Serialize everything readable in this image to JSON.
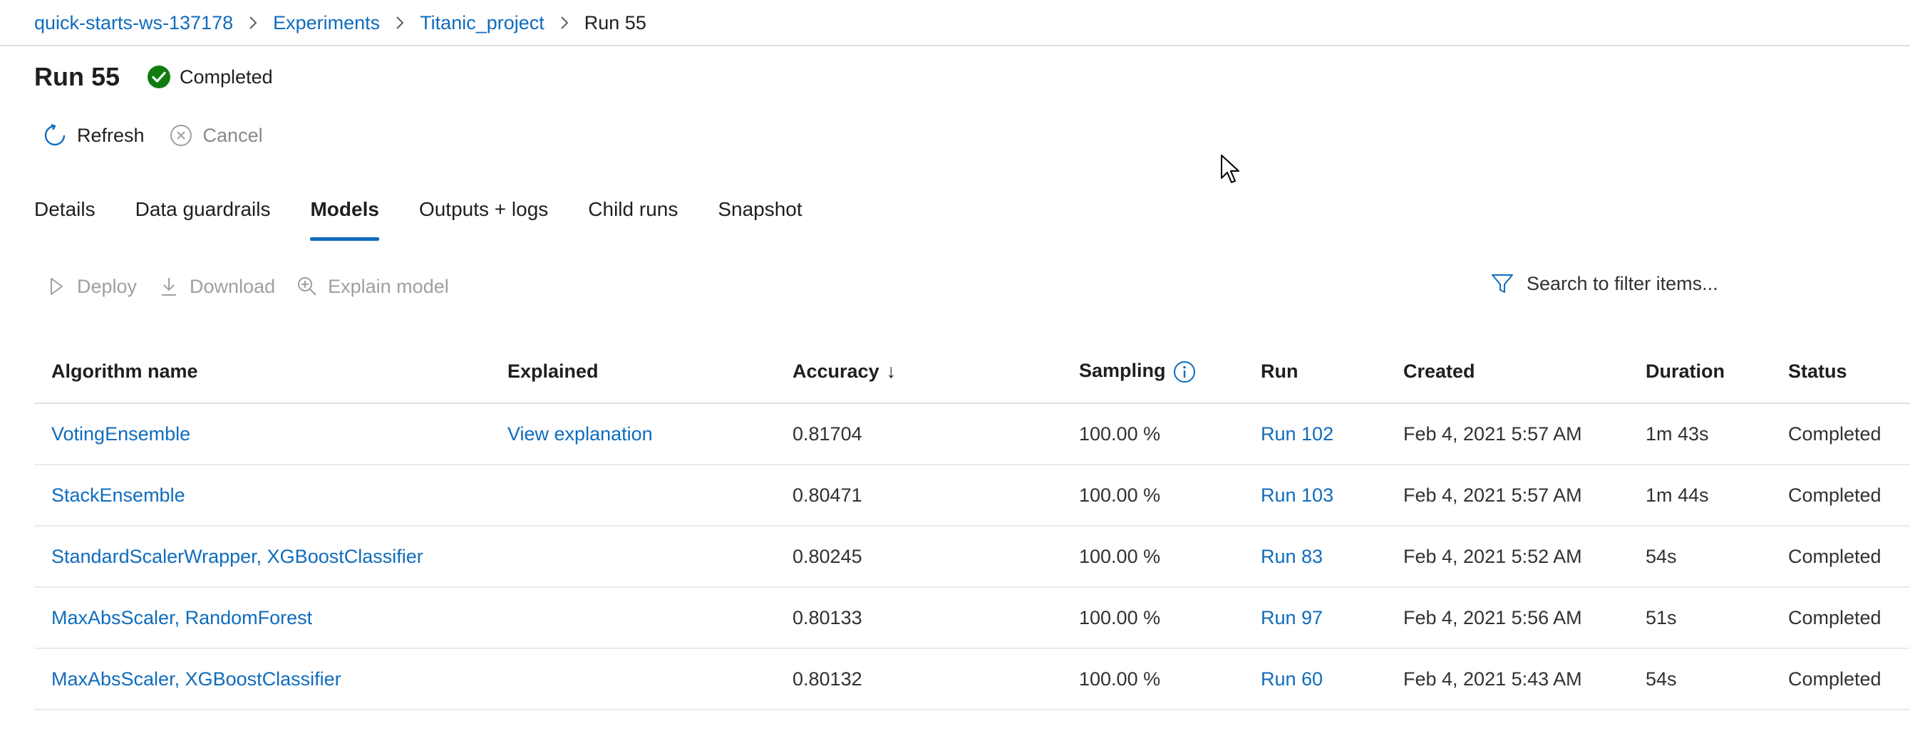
{
  "breadcrumb": {
    "items": [
      "quick-starts-ws-137178",
      "Experiments",
      "Titanic_project"
    ],
    "current": "Run 55"
  },
  "header": {
    "title": "Run 55",
    "status": "Completed",
    "status_color": "#107c10"
  },
  "commands": {
    "refresh": "Refresh",
    "cancel": "Cancel"
  },
  "tabs": [
    {
      "label": "Details"
    },
    {
      "label": "Data guardrails"
    },
    {
      "label": "Models",
      "active": true
    },
    {
      "label": "Outputs + logs"
    },
    {
      "label": "Child runs"
    },
    {
      "label": "Snapshot"
    }
  ],
  "toolbar": {
    "deploy": "Deploy",
    "download": "Download",
    "explain": "Explain model",
    "search_placeholder": "Search to filter items..."
  },
  "table": {
    "columns": {
      "algorithm": "Algorithm name",
      "explained": "Explained",
      "accuracy": "Accuracy",
      "accuracy_sort": "↓",
      "sampling": "Sampling",
      "run": "Run",
      "created": "Created",
      "duration": "Duration",
      "status": "Status"
    },
    "rows": [
      {
        "algorithm": "VotingEnsemble",
        "explained": "View explanation",
        "accuracy": "0.81704",
        "sampling": "100.00 %",
        "run": "Run 102",
        "created": "Feb 4, 2021 5:57 AM",
        "duration": "1m 43s",
        "status": "Completed"
      },
      {
        "algorithm": "StackEnsemble",
        "explained": "",
        "accuracy": "0.80471",
        "sampling": "100.00 %",
        "run": "Run 103",
        "created": "Feb 4, 2021 5:57 AM",
        "duration": "1m 44s",
        "status": "Completed"
      },
      {
        "algorithm": "StandardScalerWrapper, XGBoostClassifier",
        "explained": "",
        "accuracy": "0.80245",
        "sampling": "100.00 %",
        "run": "Run 83",
        "created": "Feb 4, 2021 5:52 AM",
        "duration": "54s",
        "status": "Completed"
      },
      {
        "algorithm": "MaxAbsScaler, RandomForest",
        "explained": "",
        "accuracy": "0.80133",
        "sampling": "100.00 %",
        "run": "Run 97",
        "created": "Feb 4, 2021 5:56 AM",
        "duration": "51s",
        "status": "Completed"
      },
      {
        "algorithm": "MaxAbsScaler, XGBoostClassifier",
        "explained": "",
        "accuracy": "0.80132",
        "sampling": "100.00 %",
        "run": "Run 60",
        "created": "Feb 4, 2021 5:43 AM",
        "duration": "54s",
        "status": "Completed"
      }
    ]
  },
  "colors": {
    "link": "#0f6cbd",
    "text": "#201f1e",
    "disabled": "#a19f9d"
  }
}
